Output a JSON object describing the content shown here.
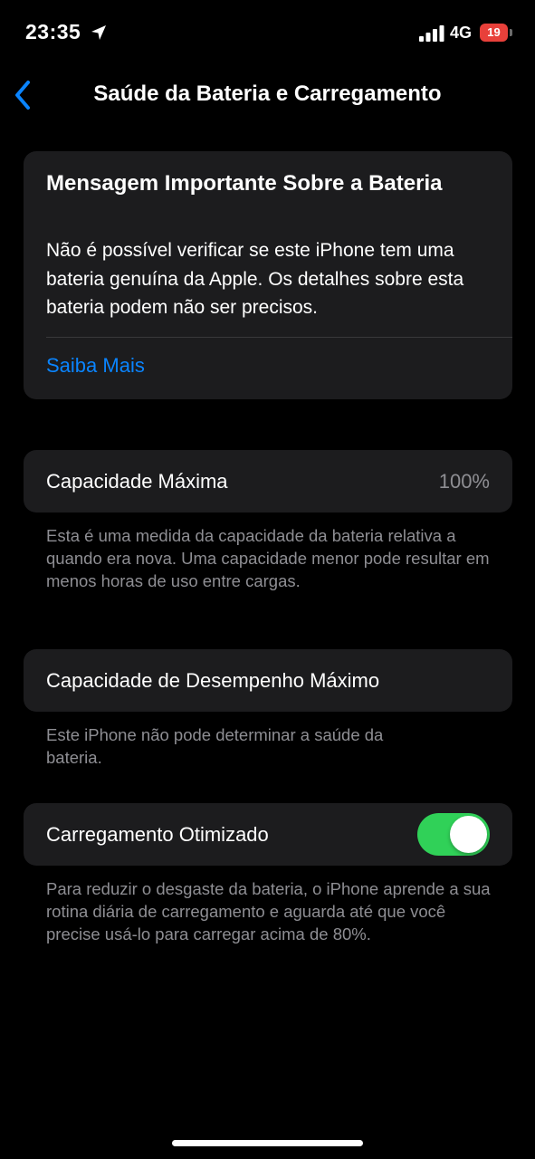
{
  "status_bar": {
    "time": "23:35",
    "network": "4G",
    "battery_level": "19"
  },
  "nav": {
    "title": "Saúde da Bateria e Carregamento"
  },
  "important_message": {
    "title": "Mensagem Importante Sobre a Bateria",
    "body": "Não é possível verificar se este iPhone tem uma bateria genuína da Apple. Os detalhes sobre esta bateria podem não ser precisos.",
    "link_label": "Saiba Mais"
  },
  "max_capacity": {
    "label": "Capacidade Máxima",
    "value": "100%",
    "footnote": "Esta é uma medida da capacidade da bateria relativa a quando era nova. Uma capacidade menor pode resultar em menos horas de uso entre cargas."
  },
  "peak_performance": {
    "label": "Capacidade de Desempenho Máximo",
    "footnote": "Este iPhone não pode determinar a saúde da bateria."
  },
  "optimized_charging": {
    "label": "Carregamento Otimizado",
    "enabled": true,
    "footnote": "Para reduzir o desgaste da bateria, o iPhone aprende a sua rotina diária de carregamento e aguarda até que você precise usá-lo para carregar acima de 80%."
  },
  "colors": {
    "accent": "#0a84ff",
    "toggle_on": "#30d158",
    "battery_low": "#e8403a",
    "card_background": "#1c1c1e",
    "secondary_text": "#8e8e93"
  },
  "icons": {
    "location": "location-arrow-icon",
    "signal": "cellular-signal-icon",
    "battery": "battery-icon",
    "back": "chevron-left-icon"
  }
}
